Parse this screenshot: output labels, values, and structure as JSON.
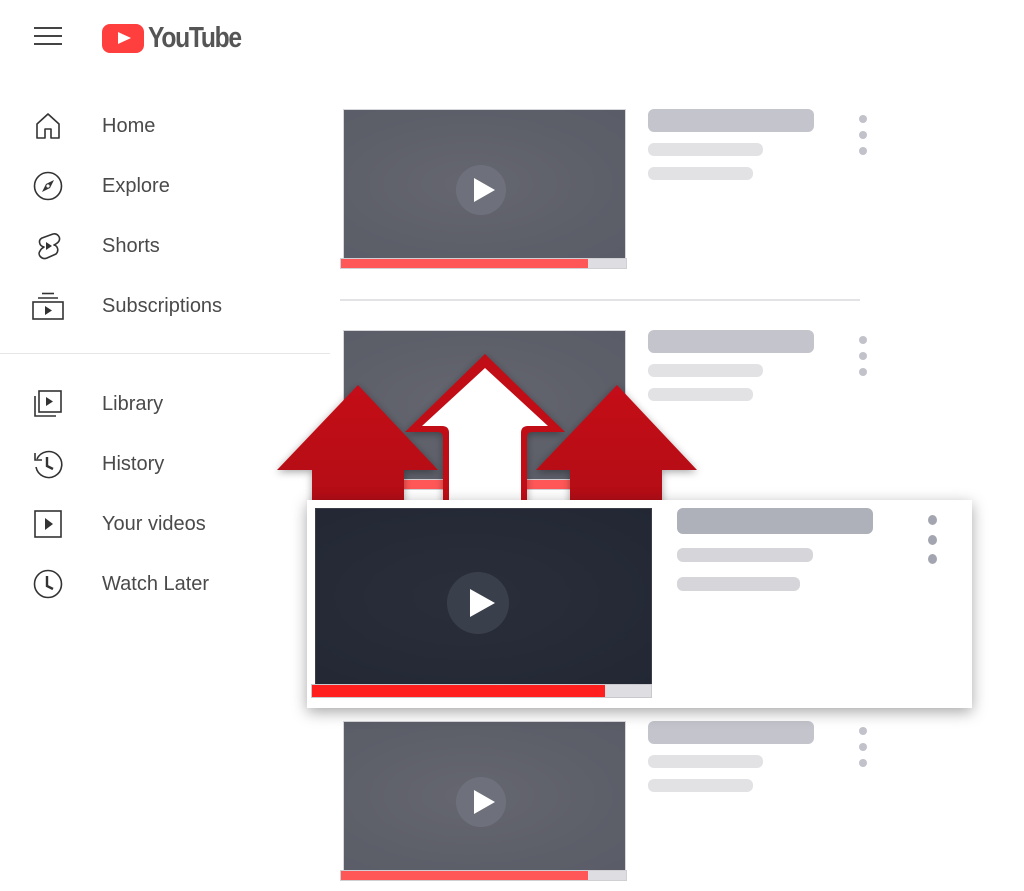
{
  "header": {
    "menu_icon": "hamburger-menu-icon",
    "logo_text": "YouTube",
    "logo_icon": "youtube-play-logo-icon"
  },
  "sidebar": {
    "primary": [
      {
        "label": "Home",
        "icon": "home-icon"
      },
      {
        "label": "Explore",
        "icon": "compass-icon"
      },
      {
        "label": "Shorts",
        "icon": "shorts-icon"
      },
      {
        "label": "Subscriptions",
        "icon": "subscriptions-icon"
      }
    ],
    "secondary": [
      {
        "label": "Library",
        "icon": "library-icon"
      },
      {
        "label": "History",
        "icon": "history-icon"
      },
      {
        "label": "Your videos",
        "icon": "your-videos-icon"
      },
      {
        "label": "Watch Later",
        "icon": "watch-later-icon"
      }
    ]
  },
  "feed": {
    "videos": [
      {
        "watched_fraction": 0.865,
        "icon": "play-icon",
        "menu_icon": "more-vert-icon"
      },
      {
        "watched_fraction": 0.865,
        "icon": "play-icon",
        "menu_icon": "more-vert-icon"
      },
      {
        "watched_fraction": 0.865,
        "icon": "play-icon",
        "menu_icon": "more-vert-icon"
      }
    ],
    "highlighted": {
      "watched_fraction": 0.865,
      "icon": "play-icon",
      "menu_icon": "more-vert-icon"
    }
  },
  "overlay": {
    "arrows": [
      "up-arrow-icon",
      "up-arrow-icon",
      "up-arrow-icon"
    ]
  },
  "colors": {
    "brand_red": "#ff3e3e",
    "progress_red": "#ff5757",
    "highlight_progress_red": "#ff1f1f",
    "arrow_red": "#c00a12"
  }
}
